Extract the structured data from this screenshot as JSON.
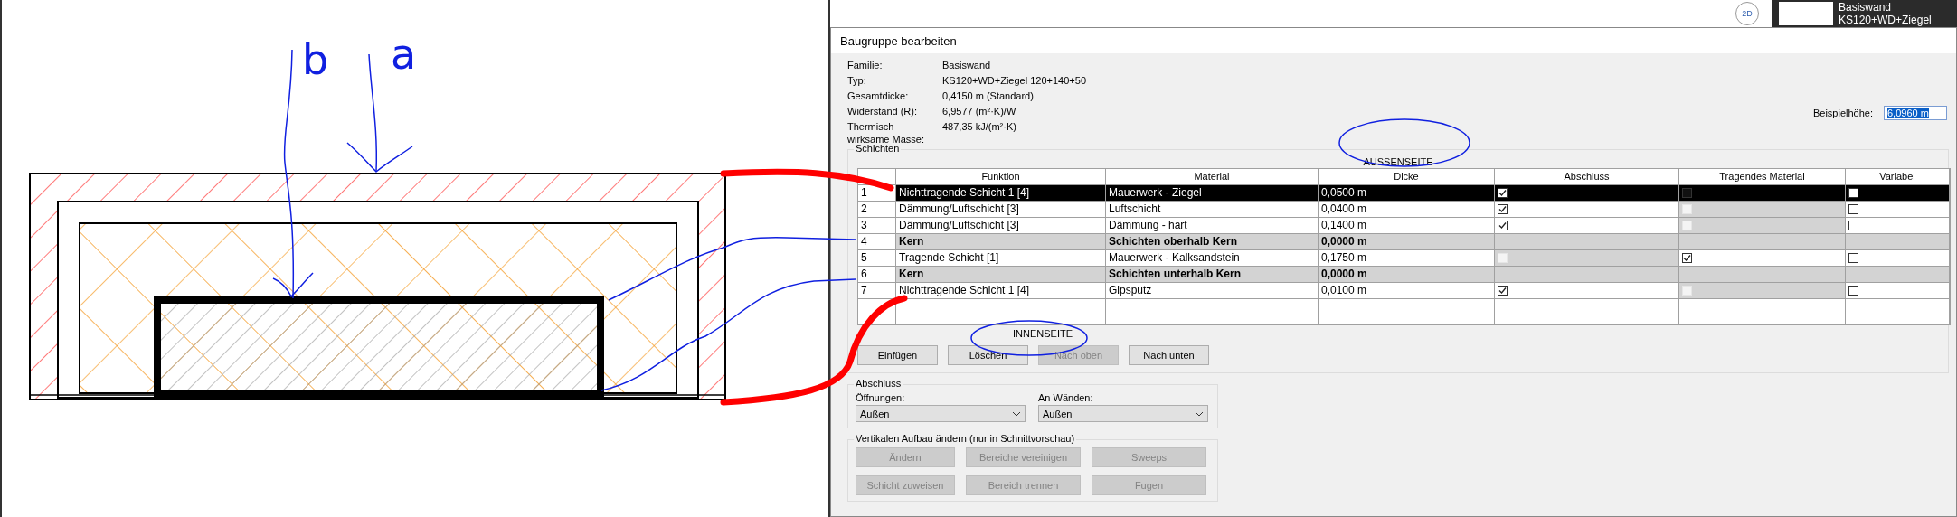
{
  "annotations": {
    "letters": [
      "b",
      "a"
    ]
  },
  "view_control": {
    "label": "2D"
  },
  "type_preview": {
    "lines": [
      "Basiswand",
      "KS120+WD+Ziegel"
    ]
  },
  "dialog": {
    "title": "Baugruppe bearbeiten",
    "properties": [
      {
        "label": "Familie:",
        "value": "Basiswand"
      },
      {
        "label": "Typ:",
        "value": "KS120+WD+Ziegel  120+140+50"
      },
      {
        "label": "Gesamtdicke:",
        "value": "0,4150 m (Standard)"
      },
      {
        "label": "Widerstand (R):",
        "value": "6,9577 (m²·K)/W"
      },
      {
        "label": "Thermisch wirksame Masse:",
        "value": "487,35 kJ/(m²·K)"
      }
    ],
    "sample_height": {
      "label": "Beispielhöhe:",
      "value": "6,0960 m"
    },
    "layers": {
      "title": "Schichten",
      "outside_label": "AUSSENSEITE",
      "inside_label": "INNENSEITE",
      "columns": [
        "Funktion",
        "Material",
        "Dicke",
        "Abschluss",
        "Tragendes Material",
        "Variabel"
      ],
      "rows": [
        {
          "kind": "layer",
          "number": "1",
          "function": "Nichttragende Schicht 1 [4]",
          "material": "Mauerwerk - Ziegel",
          "thickness": "0,0500 m",
          "selected": true,
          "closure": {
            "checked": true,
            "disabled": false
          },
          "structural": {
            "checked": false,
            "disabled": true
          },
          "variable": {
            "checked": false
          }
        },
        {
          "kind": "layer",
          "number": "2",
          "function": "Dämmung/Luftschicht [3]",
          "material": "Luftschicht",
          "thickness": "0,0400 m",
          "selected": false,
          "closure": {
            "checked": true,
            "disabled": false
          },
          "structural": {
            "checked": false,
            "disabled": true
          },
          "variable": {
            "checked": false
          }
        },
        {
          "kind": "layer",
          "number": "3",
          "function": "Dämmung/Luftschicht [3]",
          "material": "Dämmung - hart",
          "thickness": "0,1400 m",
          "selected": false,
          "closure": {
            "checked": true,
            "disabled": false
          },
          "structural": {
            "checked": false,
            "disabled": true
          },
          "variable": {
            "checked": false
          }
        },
        {
          "kind": "core",
          "number": "4",
          "function": "Kern",
          "material": "Schichten oberhalb Kern",
          "thickness": "0,0000 m",
          "selected": false
        },
        {
          "kind": "layer",
          "number": "5",
          "function": "Tragende Schicht [1]",
          "material": "Mauerwerk - Kalksandstein",
          "thickness": "0,1750 m",
          "selected": false,
          "closure": {
            "checked": false,
            "disabled": true
          },
          "structural": {
            "checked": true,
            "disabled": false
          },
          "variable": {
            "checked": false
          }
        },
        {
          "kind": "core",
          "number": "6",
          "function": "Kern",
          "material": "Schichten unterhalb Kern",
          "thickness": "0,0000 m",
          "selected": false
        },
        {
          "kind": "layer",
          "number": "7",
          "function": "Nichttragende Schicht 1 [4]",
          "material": "Gipsputz",
          "thickness": "0,0100 m",
          "selected": false,
          "closure": {
            "checked": true,
            "disabled": false
          },
          "structural": {
            "checked": false,
            "disabled": true
          },
          "variable": {
            "checked": false
          }
        }
      ],
      "buttons": [
        {
          "label": "Einfügen",
          "disabled": false
        },
        {
          "label": "Löschen",
          "disabled": false
        },
        {
          "label": "Nach oben",
          "disabled": true
        },
        {
          "label": "Nach unten",
          "disabled": false
        }
      ]
    },
    "closure_group": {
      "title": "Abschluss",
      "dropdowns": [
        {
          "label": "Öffnungen:",
          "value": "Außen"
        },
        {
          "label": "An Wänden:",
          "value": "Außen"
        }
      ]
    },
    "vertical_group": {
      "title": "Vertikalen Aufbau ändern (nur in Schnittvorschau)",
      "buttons": [
        {
          "label": "Ändern",
          "disabled": true
        },
        {
          "label": "Bereiche vereinigen",
          "disabled": true
        },
        {
          "label": "Sweeps",
          "disabled": true
        },
        {
          "label": "Schicht zuweisen",
          "disabled": true
        },
        {
          "label": "Bereich trennen",
          "disabled": true
        },
        {
          "label": "Fugen",
          "disabled": true
        }
      ]
    }
  }
}
